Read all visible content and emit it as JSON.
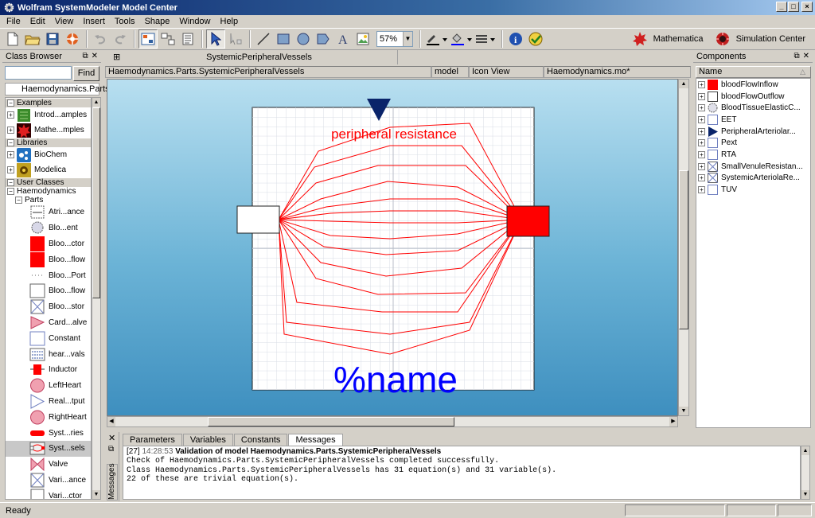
{
  "window": {
    "title": "Wolfram SystemModeler Model Center"
  },
  "menu": [
    "File",
    "Edit",
    "View",
    "Insert",
    "Tools",
    "Shape",
    "Window",
    "Help"
  ],
  "toolbar": {
    "zoom": "57%",
    "mathematica_label": "Mathematica",
    "simulation_label": "Simulation Center"
  },
  "class_browser": {
    "title": "Class Browser",
    "find_label": "Find",
    "search_value": "",
    "current_path": "Haemodynamics.Parts",
    "groups": {
      "examples": "Examples",
      "libraries": "Libraries",
      "user_classes": "User Classes"
    },
    "examples": [
      "Introd...amples",
      "Mathe...mples"
    ],
    "libraries": [
      "BioChem",
      "Modelica"
    ],
    "user_tree": {
      "root": "Haemodynamics",
      "parts": "Parts"
    },
    "parts": [
      "Atri...ance",
      "Blo...ent",
      "Bloo...ctor",
      "Bloo...flow",
      "Bloo...Port",
      "Bloo...flow",
      "Bloo...stor",
      "Card...alve",
      "Constant",
      "hear...vals",
      "Inductor",
      "LeftHeart",
      "Real...tput",
      "RightHeart",
      "Syst...ries",
      "Syst...sels",
      "Valve",
      "Vari...ance",
      "Vari...ctor"
    ]
  },
  "editor": {
    "tab_title": "SystemicPeripheralVessels",
    "class_path": "Haemodynamics.Parts.SystemicPeripheralVessels",
    "class_kind": "model",
    "view_mode": "Icon View",
    "file_name": "Haemodynamics.mo*",
    "icon_label": "peripheral resistance",
    "name_placeholder": "%name"
  },
  "messages": {
    "tabs": [
      "Parameters",
      "Variables",
      "Constants",
      "Messages"
    ],
    "side_label": "Messages",
    "entry_id": "[27]",
    "entry_time": "14:28:53",
    "entry_title": "Validation of model Haemodynamics.Parts.SystemicPeripheralVessels",
    "lines": [
      "Check of Haemodynamics.Parts.SystemicPeripheralVessels completed successfully.",
      "",
      "Class Haemodynamics.Parts.SystemicPeripheralVessels has 31 equation(s) and 31 variable(s).",
      "22 of these are trivial equation(s)."
    ]
  },
  "components": {
    "title": "Components",
    "column": "Name",
    "items": [
      "bloodFlowInflow",
      "bloodFlowOutflow",
      "BloodTissueElasticC...",
      "EET",
      "PeripheralArteriolar...",
      "Pext",
      "RTA",
      "SmallVenuleResistan...",
      "SystemicArteriolaRe...",
      "TUV"
    ]
  },
  "status": {
    "text": "Ready"
  },
  "colors": {
    "resistance_red": "#ff0000",
    "name_blue": "#0000ff",
    "navy_marker": "#0a246a",
    "canvas_top": "#b8dff0",
    "canvas_bottom": "#3e8fbf"
  }
}
